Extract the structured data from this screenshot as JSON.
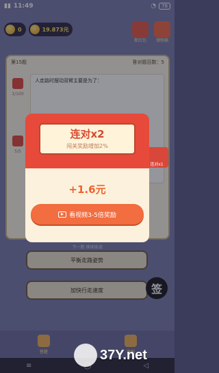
{
  "status": {
    "time": "11:49",
    "battery": "78"
  },
  "top": {
    "coins": "0",
    "cash": "19.873元",
    "tool1": "斯红包",
    "tool2": "储物箱"
  },
  "question": {
    "level": "第15题",
    "progress": "答对题目数：5",
    "side_top_count": "1/100",
    "side_bottom_count": "5/5",
    "text": "人走路时摆动双臂主要是为了："
  },
  "answers": [
    "平衡走路姿势",
    "加快行走速度"
  ],
  "hint": "下一题  继续挑战",
  "popup": {
    "combo_title": "连对x2",
    "combo_sub": "闯关奖励增加2%",
    "reward": "+1.6元",
    "video_button": "看视频3-5倍奖励"
  },
  "side_right_label": "连对x1",
  "sign_button": "签",
  "nav": {
    "left": "答题",
    "right": "我的"
  },
  "watermark": "37Y.net",
  "colors": {
    "accent": "#e74a3a",
    "button": "#f26d3f",
    "bg": "#7b7fae"
  }
}
